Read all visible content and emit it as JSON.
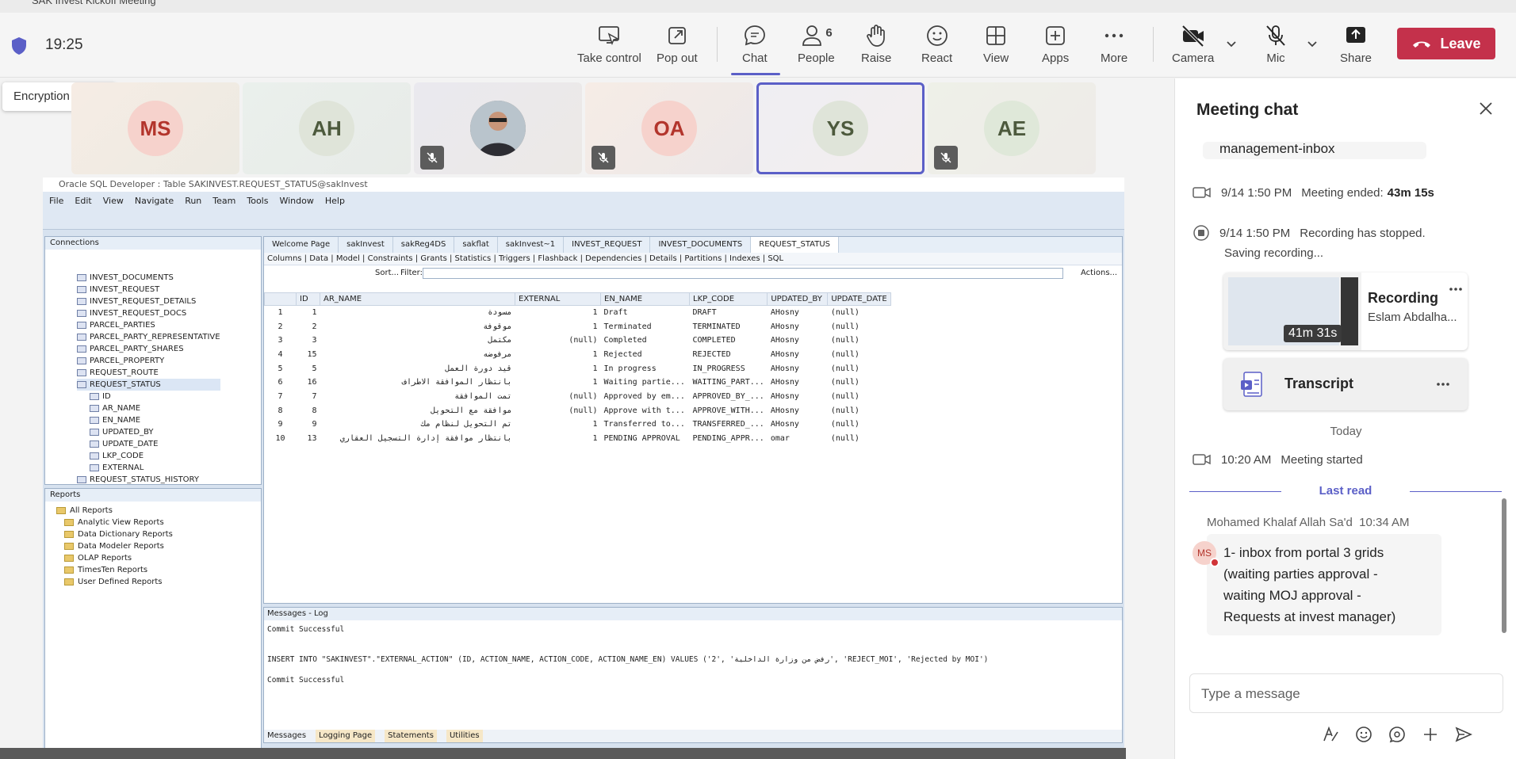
{
  "window": {
    "title": "SAK Invest Kickoff Meeting"
  },
  "toolbar": {
    "time": "19:25",
    "encryption_tooltip": "Encryption status",
    "buttons": {
      "take_control": "Take control",
      "pop_out": "Pop out",
      "chat": "Chat",
      "people": "People",
      "people_count": "6",
      "raise": "Raise",
      "react": "React",
      "view": "View",
      "apps": "Apps",
      "more": "More",
      "camera": "Camera",
      "mic": "Mic",
      "share": "Share",
      "leave": "Leave"
    },
    "colors": {
      "accent": "#5b5fc7",
      "leave": "#c4314b"
    }
  },
  "participants": [
    {
      "initials": "MS",
      "muted": false,
      "color": "#f6d2cc",
      "text": "#b3352c"
    },
    {
      "initials": "AH",
      "muted": false,
      "color": "#dfe4d9",
      "text": "#4d5a3d"
    },
    {
      "initials": "",
      "muted": true,
      "photo": true
    },
    {
      "initials": "OA",
      "muted": true,
      "color": "#f6d2cc",
      "text": "#b3352c"
    },
    {
      "initials": "YS",
      "muted": false,
      "selected": true,
      "color": "#dfe4d9",
      "text": "#4d5a3d"
    },
    {
      "initials": "AE",
      "muted": true,
      "color": "#dfe8d9",
      "text": "#4d5a3d"
    }
  ],
  "sqldev": {
    "title": "Oracle SQL Developer : Table SAKINVEST.REQUEST_STATUS@sakInvest",
    "menu": [
      "File",
      "Edit",
      "View",
      "Navigate",
      "Run",
      "Team",
      "Tools",
      "Window",
      "Help"
    ],
    "connections_label": "Connections",
    "tree": [
      "INVEST_DOCUMENTS",
      "INVEST_REQUEST",
      "INVEST_REQUEST_DETAILS",
      "INVEST_REQUEST_DOCS",
      "PARCEL_PARTIES",
      "PARCEL_PARTY_REPRESENTATIVE",
      "PARCEL_PARTY_SHARES",
      "PARCEL_PROPERTY",
      "REQUEST_ROUTE",
      "REQUEST_STATUS",
      "ID",
      "AR_NAME",
      "EN_NAME",
      "UPDATED_BY",
      "UPDATE_DATE",
      "LKP_CODE",
      "EXTERNAL",
      "REQUEST_STATUS_HISTORY"
    ],
    "reports_label": "Reports",
    "reports": [
      "All Reports",
      "Analytic View Reports",
      "Data Dictionary Reports",
      "Data Modeler Reports",
      "OLAP Reports",
      "TimesTen Reports",
      "User Defined Reports"
    ],
    "tabs": [
      "Welcome Page",
      "sakInvest",
      "sakReg4DS",
      "sakflat",
      "sakInvest~1",
      "INVEST_REQUEST",
      "INVEST_DOCUMENTS",
      "REQUEST_STATUS"
    ],
    "subtabs": "Columns | Data | Model | Constraints | Grants | Statistics | Triggers | Flashback | Dependencies | Details | Partitions | Indexes | SQL",
    "sort_label": "Sort...",
    "filter_label": "Filter:",
    "actions_label": "Actions...",
    "columns": [
      "",
      "ID",
      "AR_NAME",
      "EXTERNAL",
      "EN_NAME",
      "LKP_CODE",
      "UPDATED_BY",
      "UPDATE_DATE"
    ],
    "rows": [
      [
        "1",
        "1",
        "مسودة",
        "1",
        "Draft",
        "DRAFT",
        "AHosny",
        "(null)"
      ],
      [
        "2",
        "2",
        "موقوفة",
        "1",
        "Terminated",
        "TERMINATED",
        "AHosny",
        "(null)"
      ],
      [
        "3",
        "3",
        "مكتمل",
        "(null)",
        "Completed",
        "COMPLETED",
        "AHosny",
        "(null)"
      ],
      [
        "4",
        "15",
        "مرفوضه",
        "1",
        "Rejected",
        "REJECTED",
        "AHosny",
        "(null)"
      ],
      [
        "5",
        "5",
        "قيد دورة العمل",
        "1",
        "In progress",
        "IN_PROGRESS",
        "AHosny",
        "(null)"
      ],
      [
        "6",
        "16",
        "بانتظار الموافقة الاطراف",
        "1",
        "Waiting partie...",
        "WAITING_PART...",
        "AHosny",
        "(null)"
      ],
      [
        "7",
        "7",
        "تمت الموافقة",
        "(null)",
        "Approved by em...",
        "APPROVED_BY_...",
        "AHosny",
        "(null)"
      ],
      [
        "8",
        "8",
        "موافقة مع التحويل",
        "(null)",
        "Approve with t...",
        "APPROVE_WITH...",
        "AHosny",
        "(null)"
      ],
      [
        "9",
        "9",
        "تم التحويل لنظام مك",
        "1",
        "Transferred to...",
        "TRANSFERRED_...",
        "AHosny",
        "(null)"
      ],
      [
        "10",
        "13",
        "بانتظار موافقة إدارة التسجيل العقاري",
        "1",
        "PENDING APPROVAL",
        "PENDING_APPR...",
        "omar",
        "(null)"
      ]
    ],
    "messages_label": "Messages - Log",
    "log": [
      "Commit Successful",
      "INSERT INTO \"SAKINVEST\".\"EXTERNAL_ACTION\" (ID, ACTION_NAME, ACTION_CODE, ACTION_NAME_EN) VALUES ('2', 'رفض من وزارة الداخلية', 'REJECT_MOI', 'Rejected by MOI')",
      "Commit Successful"
    ],
    "bottom_tabs": [
      "Messages",
      "Logging Page",
      "Statements",
      "Utilities"
    ]
  },
  "chat": {
    "title": "Meeting chat",
    "prev_bubble": "management-inbox",
    "ended_time": "9/14 1:50 PM",
    "ended_text": "Meeting ended:",
    "ended_duration": "43m 15s",
    "rec_stop_time": "9/14 1:50 PM",
    "rec_stop_text": "Recording has stopped.",
    "saving": "Saving recording...",
    "recording_title": "Recording",
    "recording_by": "Eslam Abdalha...",
    "recording_duration": "41m 31s",
    "transcript": "Transcript",
    "today": "Today",
    "started_time": "10:20 AM",
    "started_text": "Meeting started",
    "last_read": "Last read",
    "msg_author": "Mohamed Khalaf Allah Sa'd",
    "msg_time": "10:34 AM",
    "msg_avatar": "MS",
    "msg_text": "1- inbox from portal 3 grids (waiting parties approval - waiting MOJ approval - Requests at invest manager)",
    "compose_placeholder": "Type a message"
  }
}
